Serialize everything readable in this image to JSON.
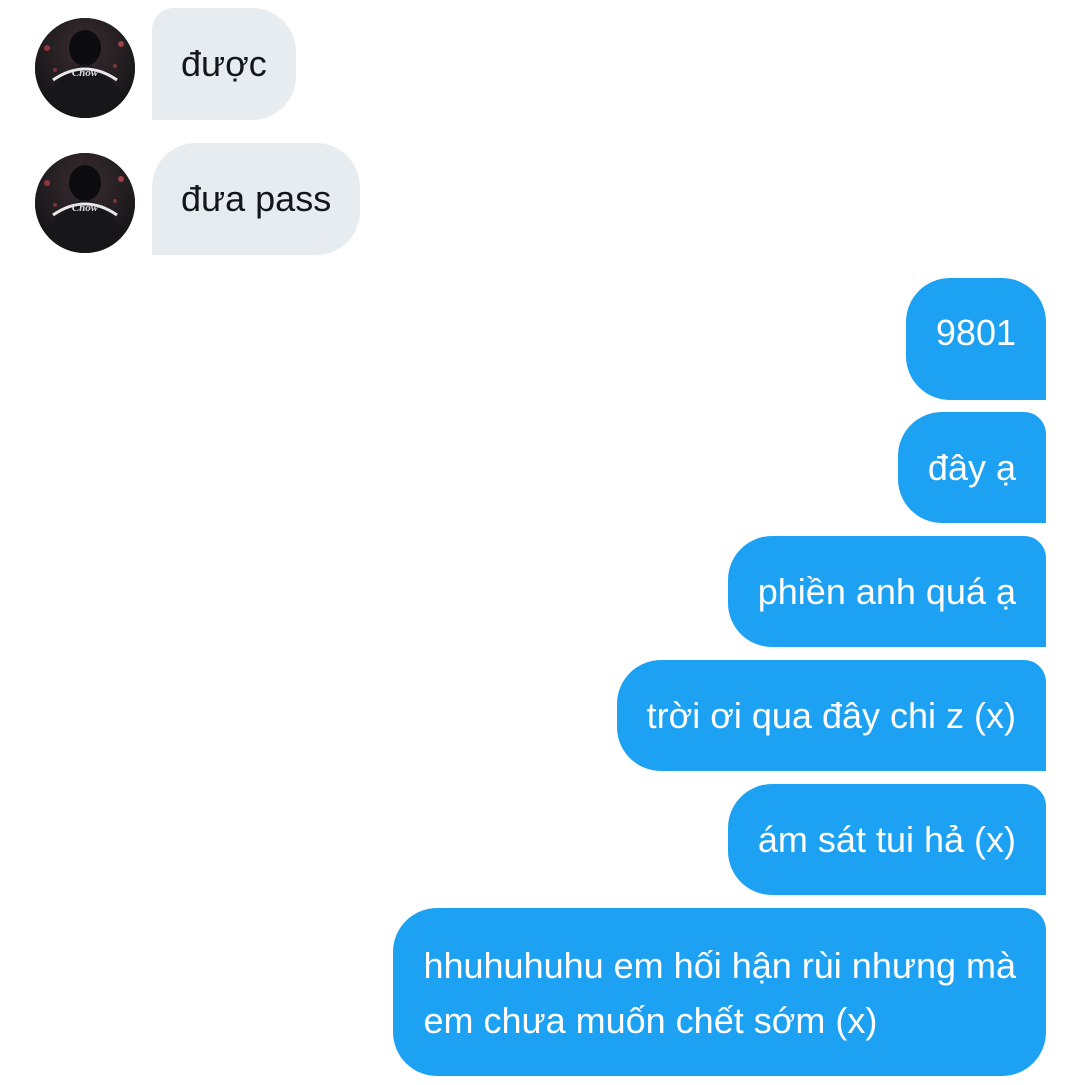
{
  "conversation": {
    "incoming": [
      {
        "text": "được"
      },
      {
        "text": "đưa pass"
      }
    ],
    "outgoing": [
      {
        "text": "9801"
      },
      {
        "text": "đây ạ"
      },
      {
        "text": "phiền anh quá ạ"
      },
      {
        "text": "trời ơi qua đây chi z (x)"
      },
      {
        "text": "ám sát tui hả (x)"
      },
      {
        "text": "hhuhuhuhu em hối hận rùi nhưng mà",
        "text_line2": "em chưa muốn chết sớm (x)"
      }
    ]
  },
  "avatar": {
    "shirt_text": "Chow"
  },
  "colors": {
    "incoming_bubble": "#e6ecf0",
    "incoming_text": "#14171a",
    "outgoing_bubble": "#1da1f2",
    "outgoing_text": "#ffffff",
    "background": "#ffffff"
  }
}
